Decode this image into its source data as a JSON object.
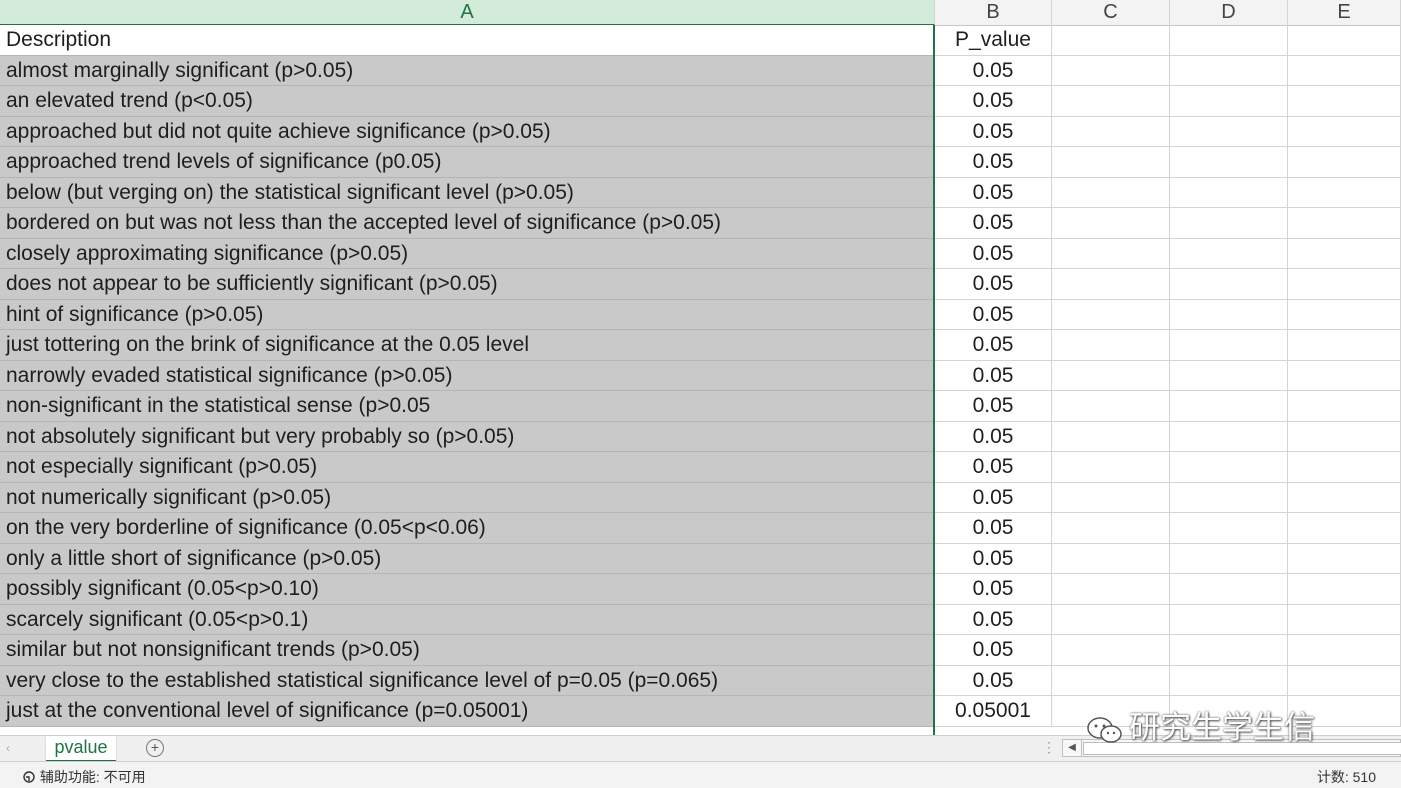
{
  "columns": [
    "A",
    "B",
    "C",
    "D",
    "E"
  ],
  "header_row": {
    "a": "Description",
    "b": "P_value"
  },
  "rows": [
    {
      "a": "almost marginally significant (p>0.05)",
      "b": "0.05"
    },
    {
      "a": "an elevated trend (p<0.05)",
      "b": "0.05"
    },
    {
      "a": "approached but did not quite achieve significance (p>0.05)",
      "b": "0.05"
    },
    {
      "a": "approached trend levels of significance (p0.05)",
      "b": "0.05"
    },
    {
      "a": "below (but verging on) the statistical significant level (p>0.05)",
      "b": "0.05"
    },
    {
      "a": "bordered on but was not less than the accepted level of significance (p>0.05)",
      "b": "0.05"
    },
    {
      "a": "closely approximating significance (p>0.05)",
      "b": "0.05"
    },
    {
      "a": "does not appear to be sufficiently significant (p>0.05)",
      "b": "0.05"
    },
    {
      "a": "hint of significance (p>0.05)",
      "b": "0.05"
    },
    {
      "a": "just tottering on the brink of significance at the 0.05 level",
      "b": "0.05"
    },
    {
      "a": "narrowly evaded statistical significance (p>0.05)",
      "b": "0.05"
    },
    {
      "a": "non-significant in the statistical sense (p>0.05",
      "b": "0.05"
    },
    {
      "a": "not absolutely significant but very probably so (p>0.05)",
      "b": "0.05"
    },
    {
      "a": "not especially significant (p>0.05)",
      "b": "0.05"
    },
    {
      "a": "not numerically significant (p>0.05)",
      "b": "0.05"
    },
    {
      "a": "on the very borderline of significance (0.05<p<0.06)",
      "b": "0.05"
    },
    {
      "a": "only a little short of significance (p>0.05)",
      "b": "0.05"
    },
    {
      "a": "possibly significant (0.05<p>0.10)",
      "b": "0.05"
    },
    {
      "a": "scarcely significant (0.05<p>0.1)",
      "b": "0.05"
    },
    {
      "a": "similar but not nonsignificant trends (p>0.05)",
      "b": "0.05"
    },
    {
      "a": "very close to the established statistical significance level of p=0.05 (p=0.065)",
      "b": "0.05"
    },
    {
      "a": "just at the conventional level of significance (p=0.05001)",
      "b": "0.05001"
    }
  ],
  "sheet_tab": "pvalue",
  "status": {
    "accessibility": "辅助功能: 不可用",
    "count": "计数: 510"
  },
  "watermark": "研究生学生信",
  "colors": {
    "accent": "#217346",
    "selection": "#c9c9c9",
    "header_selected": "#d2ecd9"
  },
  "icons": {
    "add_sheet": "plus-circle-icon",
    "accessibility": "accessibility-icon",
    "watermark": "wechat-icon"
  }
}
